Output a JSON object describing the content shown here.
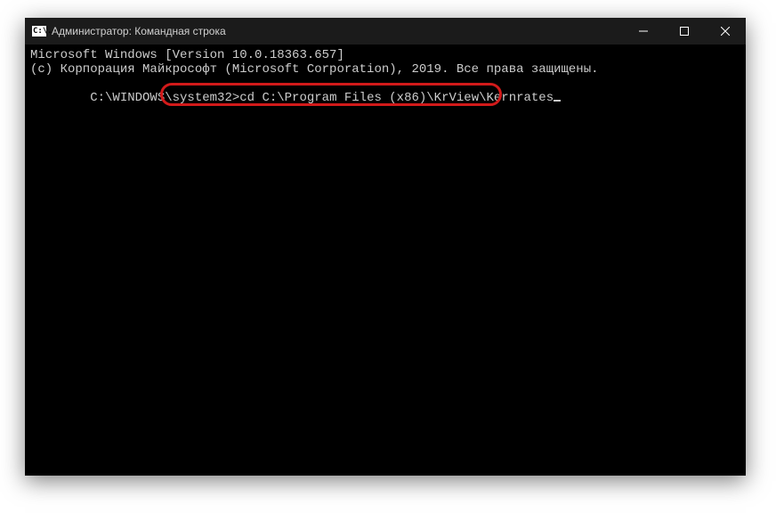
{
  "window": {
    "title": "Администратор: Командная строка",
    "icon_glyph": "C:\\."
  },
  "controls": {
    "minimize_name": "minimize-button",
    "maximize_name": "maximize-button",
    "close_name": "close-button"
  },
  "terminal": {
    "line1": "Microsoft Windows [Version 10.0.18363.657]",
    "line2": "(c) Корпорация Майкрософт (Microsoft Corporation), 2019. Все права защищены.",
    "blank": "",
    "prompt": "C:\\WINDOWS\\system32>",
    "command": "cd C:\\Program Files (x86)\\KrView\\Kernrates"
  }
}
